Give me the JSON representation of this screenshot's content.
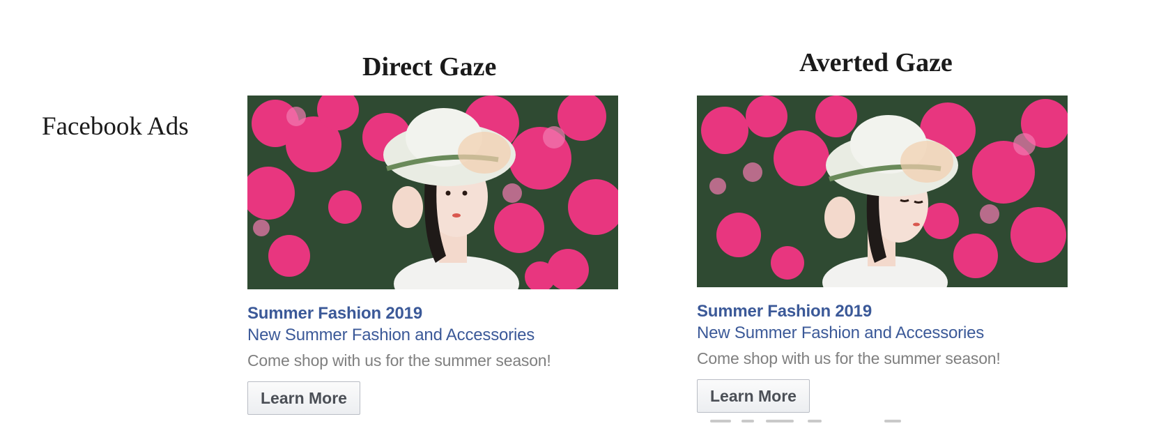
{
  "headers": {
    "direct": "Direct Gaze",
    "averted": "Averted Gaze"
  },
  "row_label": "Facebook Ads",
  "ads": [
    {
      "variant": "direct",
      "title": "Summer Fashion 2019",
      "subtitle": "New Summer Fashion and Accessories",
      "description": "Come shop with us for the summer season!",
      "button_label": "Learn More"
    },
    {
      "variant": "averted",
      "title": "Summer Fashion 2019",
      "subtitle": "New Summer Fashion and Accessories",
      "description": "Come shop with us for the summer season!",
      "button_label": "Learn More"
    }
  ],
  "colors": {
    "link_blue": "#3b5998",
    "muted_text": "#7f7f7f",
    "flowers_pink": "#e8367f",
    "foliage_green": "#2f4a32"
  }
}
